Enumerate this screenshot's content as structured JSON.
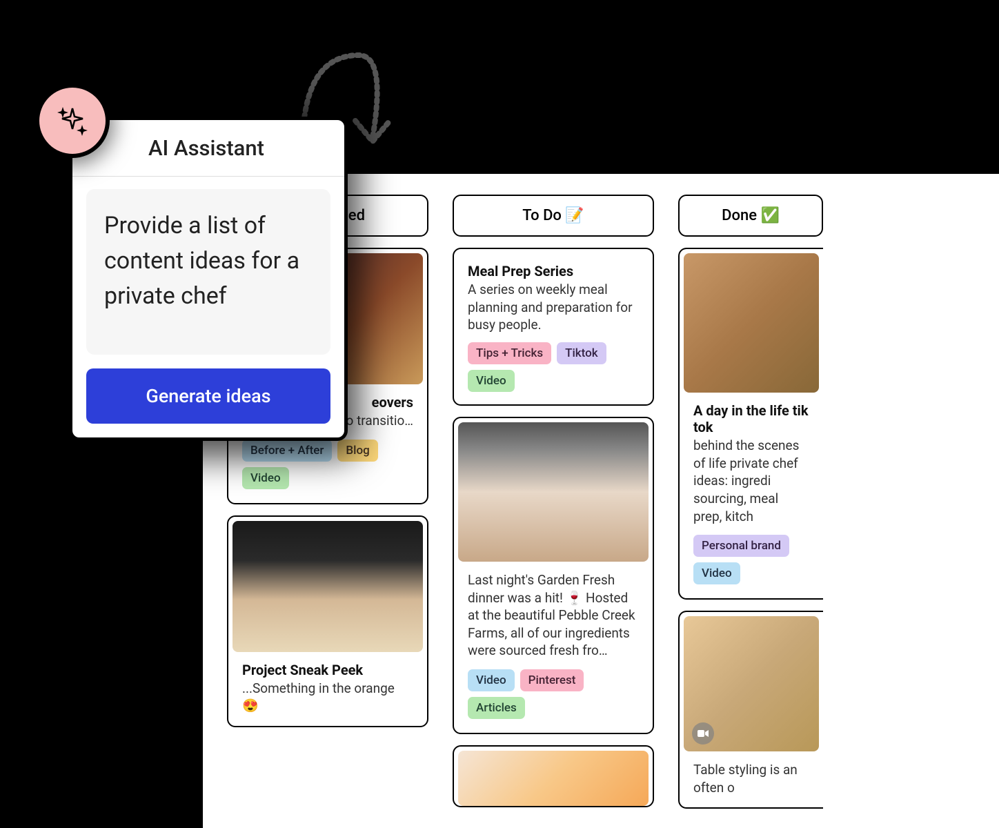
{
  "ai": {
    "title": "AI Assistant",
    "prompt": "Provide a list of content ideas for a private chef",
    "button": "Generate ideas"
  },
  "columns": {
    "planned": {
      "label": "ned",
      "cards": [
        {
          "title": "eovers",
          "desc": "eo transitio…",
          "tags": [
            {
              "label": "Before + After",
              "class": "tag-blue"
            },
            {
              "label": "Blog",
              "class": "tag-yellow"
            },
            {
              "label": "Video",
              "class": "tag-green"
            }
          ]
        },
        {
          "title": "Project Sneak Peek",
          "desc": "...Something in the orange 😍"
        }
      ]
    },
    "todo": {
      "label": "To Do 📝",
      "cards": [
        {
          "title": "Meal Prep Series",
          "desc": "A series on weekly meal planning and preparation for busy people.",
          "tags": [
            {
              "label": "Tips + Tricks",
              "class": "tag-pink"
            },
            {
              "label": "Tiktok",
              "class": "tag-purple"
            },
            {
              "label": "Video",
              "class": "tag-green"
            }
          ]
        },
        {
          "desc": "Last night's Garden Fresh dinner was a hit! 🍷 Hosted at the beautiful Pebble Creek Farms, all of our ingredients were sourced fresh fro…",
          "tags": [
            {
              "label": "Video",
              "class": "tag-lightblue"
            },
            {
              "label": "Pinterest",
              "class": "tag-pink"
            },
            {
              "label": "Articles",
              "class": "tag-green"
            }
          ]
        }
      ]
    },
    "done": {
      "label": "Done ✅",
      "cards": [
        {
          "title": "A day in the life tik tok",
          "desc": "behind the scenes of life private chef ideas: ingredi sourcing, meal prep, kitch",
          "tags": [
            {
              "label": "Personal brand",
              "class": "tag-purple"
            },
            {
              "label": "Video",
              "class": "tag-lightblue"
            }
          ]
        },
        {
          "desc": "Table styling is an often o"
        }
      ]
    }
  }
}
